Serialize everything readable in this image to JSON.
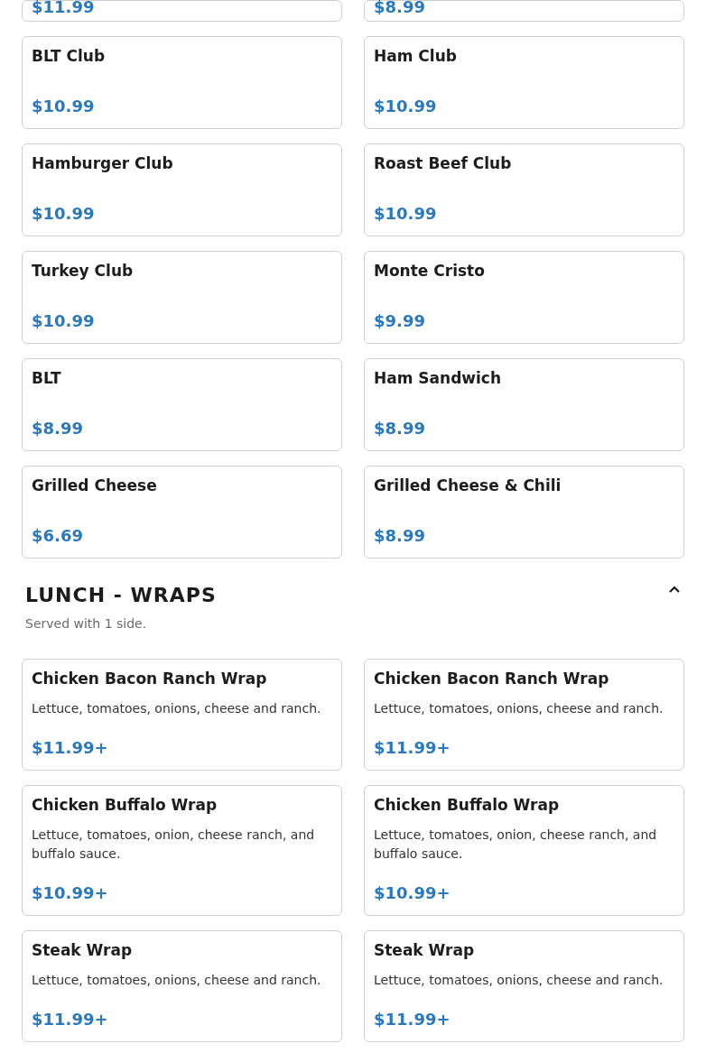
{
  "cut_off_items": [
    {
      "price": "$11.99"
    },
    {
      "price": "$8.99"
    }
  ],
  "items": [
    {
      "name": "BLT Club",
      "price": "$10.99"
    },
    {
      "name": "Ham Club",
      "price": "$10.99"
    },
    {
      "name": "Hamburger Club",
      "price": "$10.99"
    },
    {
      "name": "Roast Beef Club",
      "price": "$10.99"
    },
    {
      "name": "Turkey Club",
      "price": "$10.99"
    },
    {
      "name": "Monte Cristo",
      "price": "$9.99"
    },
    {
      "name": "BLT",
      "price": "$8.99"
    },
    {
      "name": "Ham Sandwich",
      "price": "$8.99"
    },
    {
      "name": "Grilled Cheese",
      "price": "$6.69"
    },
    {
      "name": "Grilled Cheese & Chili",
      "price": "$8.99"
    }
  ],
  "section": {
    "title": "LUNCH - WRAPS",
    "expanded": true,
    "subtitle": "Served with 1 side.",
    "items": [
      {
        "name": "Chicken Bacon Ranch Wrap",
        "description": "Lettuce, tomatoes, onions, cheese and ranch.",
        "price": "$11.99+"
      },
      {
        "name": "Chicken Bacon Ranch Wrap",
        "description": "Lettuce, tomatoes, onions, cheese and ranch.",
        "price": "$11.99+"
      },
      {
        "name": "Chicken Buffalo Wrap",
        "description": "Lettuce, tomatoes, onion, cheese ranch, and buffalo sauce.",
        "price": "$10.99+"
      },
      {
        "name": "Chicken Buffalo Wrap",
        "description": "Lettuce, tomatoes, onion, cheese ranch, and buffalo sauce.",
        "price": "$10.99+"
      },
      {
        "name": "Steak Wrap",
        "description": "Lettuce, tomatoes, onions, cheese and ranch.",
        "price": "$11.99+"
      },
      {
        "name": "Steak Wrap",
        "description": "Lettuce, tomatoes, onions, cheese and ranch.",
        "price": "$11.99+"
      }
    ]
  }
}
